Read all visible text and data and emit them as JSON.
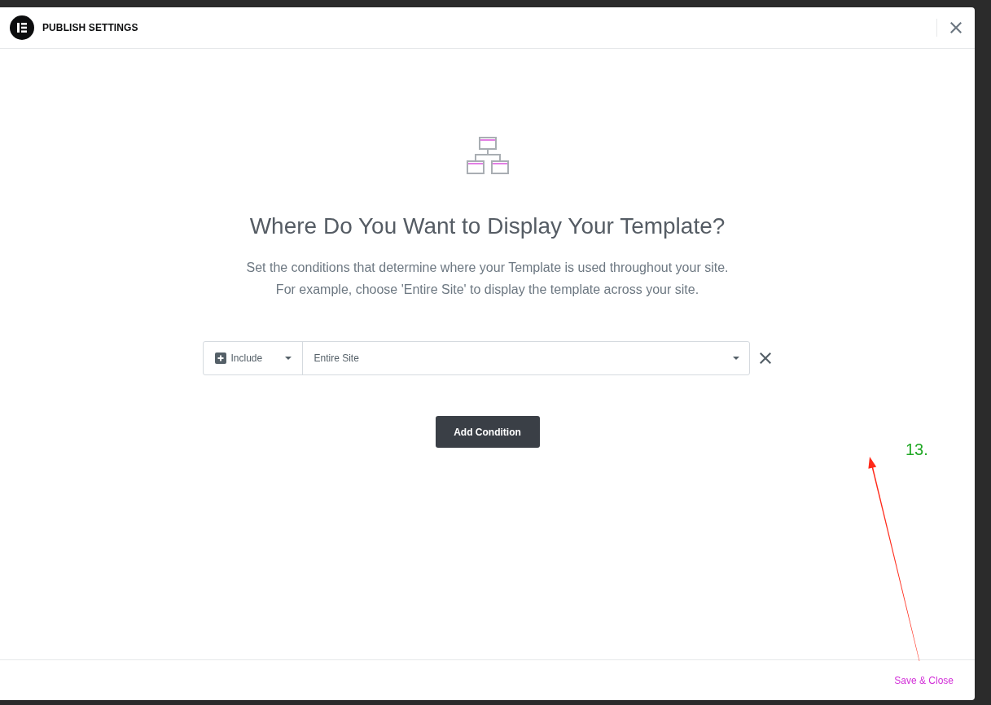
{
  "header": {
    "title": "PUBLISH SETTINGS"
  },
  "intro": {
    "title": "Where Do You Want to Display Your Template?",
    "description": [
      "Set the conditions that determine where your Template is used throughout your site.",
      "For example, choose 'Entire Site' to display the template across your site."
    ]
  },
  "conditions": [
    {
      "type": "Include",
      "target": "Entire Site"
    }
  ],
  "add_button": "Add Condition",
  "footer": {
    "save_button": "Save & Close"
  },
  "annotation": {
    "label": "13."
  }
}
